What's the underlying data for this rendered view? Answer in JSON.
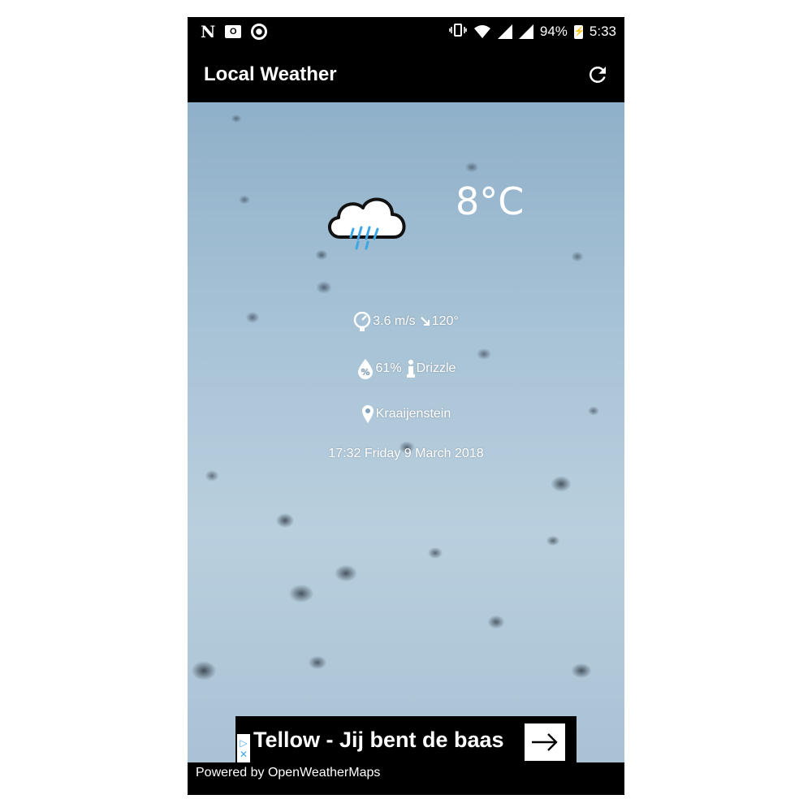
{
  "status_bar": {
    "battery": "94%",
    "time": "5:33",
    "outlook_glyph": "O"
  },
  "app_bar": {
    "title": "Local Weather",
    "refresh_icon": "refresh-icon"
  },
  "weather": {
    "icon": "rain-cloud-icon",
    "temperature": "8°C",
    "wind_speed": "3.6 m/s",
    "wind_direction": "120°",
    "humidity": "61%",
    "description": "Drizzle",
    "location": "Kraaijenstein",
    "datetime": "17:32 Friday 9 March 2018"
  },
  "ad": {
    "text": "Tellow - Jij bent de baas",
    "accent": "#3ba7e6"
  },
  "footer": {
    "text": "Powered by OpenWeatherMaps"
  }
}
